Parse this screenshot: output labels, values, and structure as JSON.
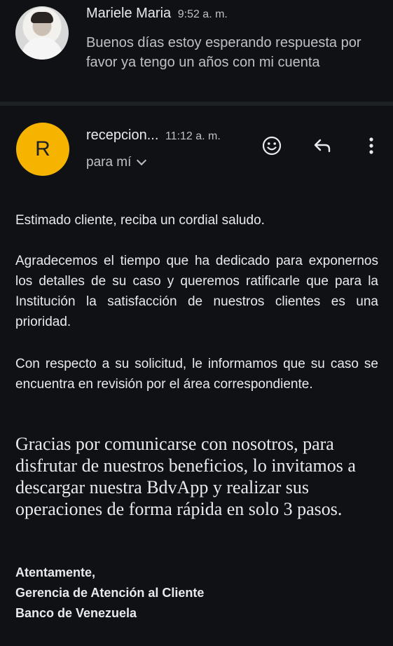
{
  "message1": {
    "sender": "Mariele Maria",
    "time": "9:52 a. m.",
    "snippet": "Buenos días estoy esperando respuesta por favor ya tengo un años con mi cuenta"
  },
  "message2": {
    "avatar_letter": "R",
    "sender": "recepcion...",
    "time": "11:12 a. m.",
    "recipient": "para mí",
    "icons": [
      "emoji-icon",
      "reply-icon",
      "more-vert-icon"
    ],
    "body": {
      "greeting": "Estimado cliente, reciba un cordial saludo.",
      "paragraph1": "Agradecemos el tiempo que ha dedicado para exponernos los detalles de su caso y queremos ratificarle que para la Institución la satisfacción de nuestros clientes es una prioridad.",
      "paragraph2": "Con respecto a su solicitud, le informamos que su caso se encuentra en revisión por el área correspondiente.",
      "promo": "Gracias por comunicarse con nosotros, para disfrutar de nuestros beneficios, lo invitamos a descargar nuestra BdvApp y realizar sus operaciones de forma rápida en solo 3 pasos.",
      "signature": [
        "Atentamente,",
        "Gerencia de Atención al Cliente",
        "Banco de Venezuela"
      ]
    }
  },
  "colors": {
    "background": "#0f1115",
    "avatar_r": "#f6b400",
    "text_primary": "#e8eaed",
    "text_secondary": "#bdc1c6"
  }
}
